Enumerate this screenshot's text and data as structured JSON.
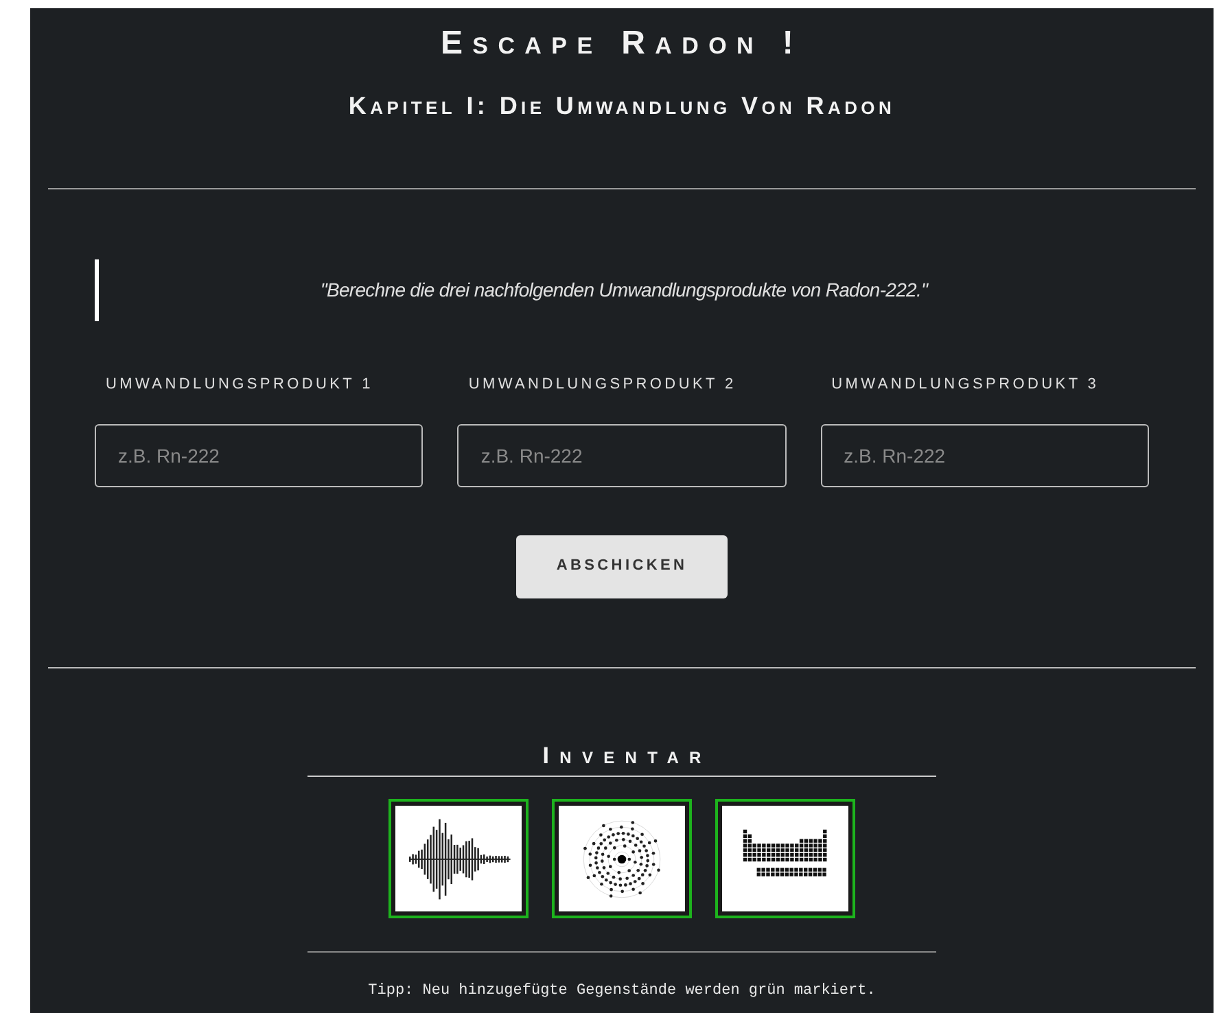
{
  "title": "Escape Radon !",
  "chapter": "Kapitel I: Die Umwandlung Von Radon",
  "quote": "\"Berechne die drei nachfolgenden Umwandlungsprodukte von Radon-222.\"",
  "fields": [
    {
      "label": "UMWANDLUNGSPRODUKT 1",
      "placeholder": "z.B. Rn-222"
    },
    {
      "label": "UMWANDLUNGSPRODUKT 2",
      "placeholder": "z.B. Rn-222"
    },
    {
      "label": "UMWANDLUNGSPRODUKT 3",
      "placeholder": "z.B. Rn-222"
    }
  ],
  "submit": "ABSCHICKEN",
  "inventory": {
    "title": "Inventar",
    "items": [
      {
        "kind": "waveform",
        "new": true
      },
      {
        "kind": "atom",
        "new": true
      },
      {
        "kind": "periodic",
        "new": true
      }
    ]
  },
  "tip": "Tipp: Neu hinzugefügte Gegenstände werden grün markiert."
}
